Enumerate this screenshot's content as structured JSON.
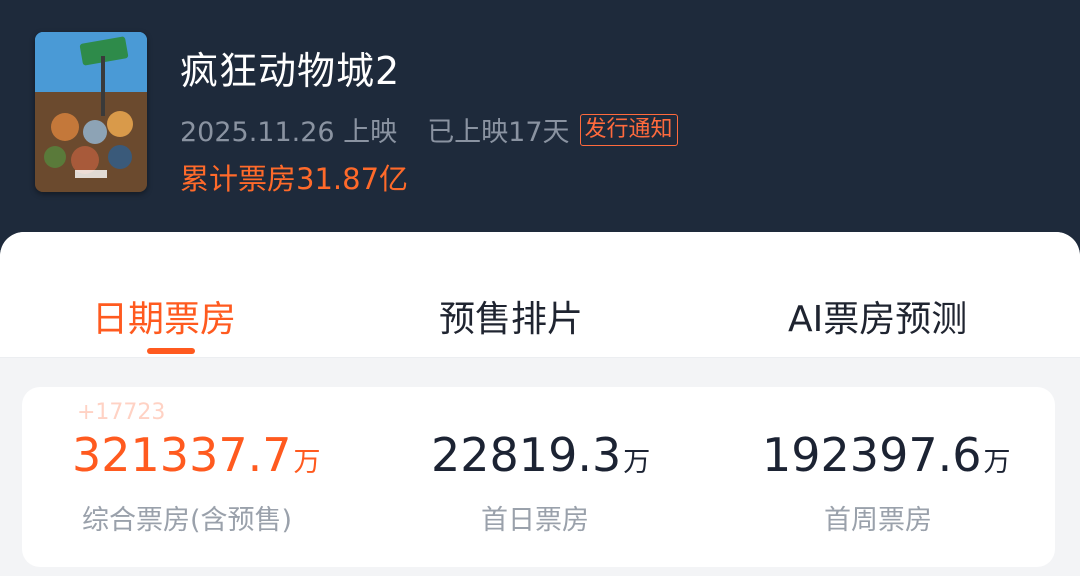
{
  "movie": {
    "title": "疯狂动物城2",
    "release": "2025.11.26 上映",
    "days_showing": "已上映17天",
    "notice": "发行通知",
    "cumulative": "累计票房31.87亿",
    "poster_icon": "movie-poster-image"
  },
  "tabs": [
    {
      "label": "日期票房",
      "active": true
    },
    {
      "label": "预售排片",
      "active": false
    },
    {
      "label": "AI票房预测",
      "active": false
    }
  ],
  "stats": {
    "delta": "+17723",
    "items": [
      {
        "value": "321337.7",
        "unit": "万",
        "label": "综合票房(含预售)"
      },
      {
        "value": "22819.3",
        "unit": "万",
        "label": "首日票房"
      },
      {
        "value": "192397.6",
        "unit": "万",
        "label": "首周票房"
      }
    ]
  },
  "colors": {
    "header_bg": "#1e2a3b",
    "accent": "#ff5a1f",
    "muted": "#8a93a1"
  }
}
